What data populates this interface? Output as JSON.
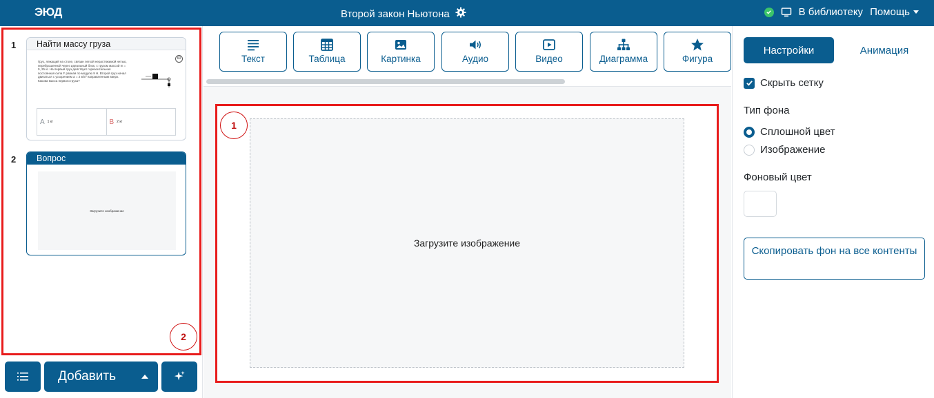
{
  "topbar": {
    "logo": "ЭЮД",
    "title": "Второй закон Ньютона",
    "library_label": "В библиотеку",
    "help_label": "Помощь",
    "bg_color": "#0a5d8f"
  },
  "slides": [
    {
      "number": "1",
      "title": "Найти массу груза",
      "badge": "60",
      "body": "Груз, лежащий на столе, связан легкой нерастяжимой нитью, переброшенной через идеальный блок, с грузом массой m = 0, 25 кг. На первый груз действует горизонтальная постоянная сила F равная по модулю 9 Н. Второй груз начал двигаться с ускорением a = 2 м/с² направленным вверх. Какова масса первого груза?",
      "answers": [
        {
          "letter": "A",
          "text": "1 кг"
        },
        {
          "letter": "B",
          "text": "2 кг"
        }
      ]
    },
    {
      "number": "2",
      "title": "Вопрос",
      "preview_text": "Загрузите изображение"
    }
  ],
  "annotations": {
    "canvas": "1",
    "sidebar": "2"
  },
  "bottom_bar": {
    "add_label": "Добавить"
  },
  "toolbar": [
    {
      "label": "Текст",
      "icon": "text-lines-icon"
    },
    {
      "label": "Таблица",
      "icon": "table-icon"
    },
    {
      "label": "Картинка",
      "icon": "image-icon"
    },
    {
      "label": "Аудио",
      "icon": "speaker-icon"
    },
    {
      "label": "Видео",
      "icon": "video-play-icon"
    },
    {
      "label": "Диаграмма",
      "icon": "hierarchy-icon"
    },
    {
      "label": "Фигура",
      "icon": "star-icon"
    }
  ],
  "canvas": {
    "placeholder": "Загрузите изображение"
  },
  "settings": {
    "tab_settings": "Настройки",
    "tab_animation": "Анимация",
    "hide_grid_label": "Скрыть сетку",
    "hide_grid_checked": true,
    "bg_type_label": "Тип фона",
    "bg_options": [
      "Сплошной цвет",
      "Изображение"
    ],
    "bg_selected": "Сплошной цвет",
    "bg_color_label": "Фоновый цвет",
    "copy_bg_label": "Скопировать фон на все контенты"
  }
}
